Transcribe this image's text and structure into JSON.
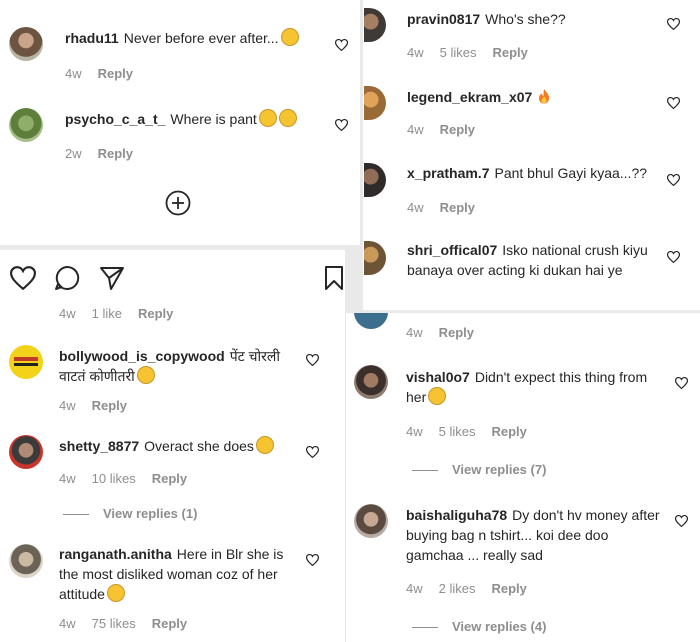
{
  "top_left": {
    "comments": [
      {
        "user": "rhadu11",
        "text": "Never before ever after...",
        "time": "4w",
        "reply": "Reply"
      },
      {
        "user": "psycho_c_a_t_",
        "text": "Where is pant",
        "time": "2w",
        "reply": "Reply"
      }
    ]
  },
  "top_right": {
    "comments": [
      {
        "user": "pravin0817",
        "text": "Who's she??",
        "time": "4w",
        "likes": "5 likes",
        "reply": "Reply"
      },
      {
        "user": "legend_ekram_x07",
        "text": "",
        "time": "4w",
        "reply": "Reply"
      },
      {
        "user": "x_pratham.7",
        "text": "Pant bhul Gayi kyaa...??",
        "time": "4w",
        "reply": "Reply"
      },
      {
        "user": "shri_offical07",
        "text": "Isko national crush kiyu banaya over acting ki dukan hai ye"
      }
    ]
  },
  "bottom_left": {
    "meta0": {
      "time": "4w",
      "likes": "1 like",
      "reply": "Reply"
    },
    "comments": [
      {
        "user": "bollywood_is_copywood",
        "text": "पेंट चोरली वाटतं कोणीतरी",
        "time": "4w",
        "reply": "Reply"
      },
      {
        "user": "shetty_8877",
        "text": "Overact she does",
        "time": "4w",
        "likes": "10 likes",
        "reply": "Reply",
        "view_replies": "View replies (1)"
      },
      {
        "user": "ranganath.anitha",
        "text": "Here in Blr she is the most disliked woman coz of her attitude",
        "time": "4w",
        "likes": "75 likes",
        "reply": "Reply"
      }
    ]
  },
  "bottom_right": {
    "meta0": {
      "time": "4w",
      "reply": "Reply"
    },
    "comments": [
      {
        "user": "vishal0o7",
        "text": "Didn't expect this thing from her",
        "time": "4w",
        "likes": "5 likes",
        "reply": "Reply",
        "view_replies": "View replies (7)"
      },
      {
        "user": "baishaliguha78",
        "text": "Dy don't hv money after buying bag n tshirt... koi dee doo gamchaa ... really sad",
        "time": "4w",
        "likes": "2 likes",
        "reply": "Reply",
        "view_replies": "View replies (4)"
      }
    ]
  },
  "icons": [
    "heart-icon",
    "comment-icon",
    "share-icon",
    "bookmark-icon",
    "add-circle-icon"
  ],
  "colors": {
    "text": "#262626",
    "muted": "#8e8e8e",
    "background": "#ffffff"
  }
}
